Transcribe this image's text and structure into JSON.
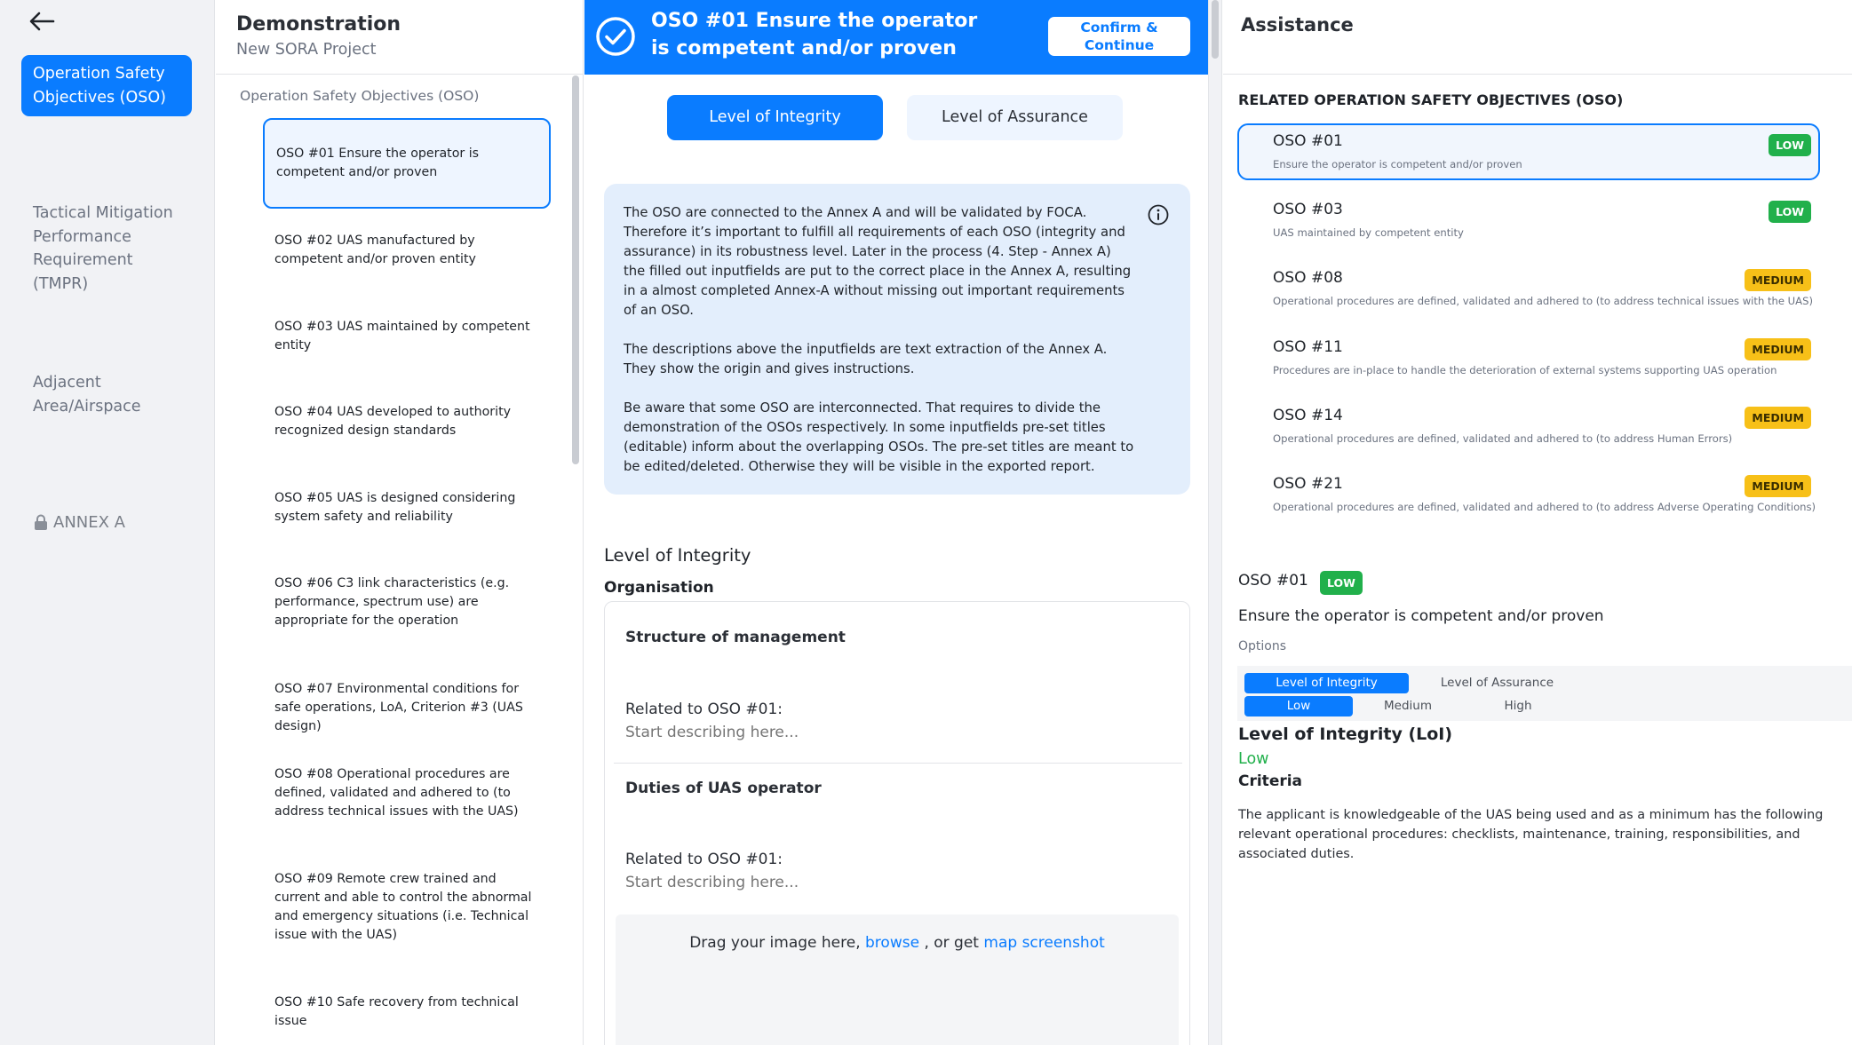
{
  "nav": {
    "items": [
      {
        "label": "Operation Safety Objectives (OSO)"
      },
      {
        "label": "Tactical Mitigation Performance Requirement (TMPR)"
      },
      {
        "label": "Adjacent Area/Airspace"
      }
    ],
    "annex_label": "ANNEX A"
  },
  "list": {
    "title": "Demonstration",
    "subtitle": "New SORA Project",
    "section": "Operation Safety Objectives (OSO)",
    "items": [
      {
        "label": "OSO #01 Ensure the operator is competent and/or proven"
      },
      {
        "label": "OSO #02 UAS manufactured by competent and/or proven entity"
      },
      {
        "label": "OSO #03 UAS maintained by competent entity"
      },
      {
        "label": "OSO #04 UAS developed to authority recognized design standards"
      },
      {
        "label": "OSO #05 UAS is designed considering system safety and reliability"
      },
      {
        "label": "OSO #06 C3 link characteristics (e.g. performance, spectrum use) are appropriate for the operation"
      },
      {
        "label": "OSO #07 Environmental conditions for safe operations, LoA, Criterion #3 (UAS design)"
      },
      {
        "label": "OSO #08 Operational procedures are defined, validated and adhered to (to address technical issues with the UAS)"
      },
      {
        "label": "OSO #09 Remote crew trained and current and able to control the abnormal and emergency situations (i.e. Technical issue with the UAS)"
      },
      {
        "label": "OSO #10 Safe recovery from technical issue"
      }
    ]
  },
  "main": {
    "banner_title": "OSO #01 Ensure the operator is competent and/or proven",
    "confirm_label": "Confirm & Continue",
    "tabs": [
      {
        "label": "Level of Integrity"
      },
      {
        "label": "Level of Assurance"
      }
    ],
    "info": [
      "The OSO are connected to the Annex A and will be validated by FOCA. Therefore it’s important to fulfill all requirements of each OSO (integrity and assurance) in its robustness level. Later in the process (4. Step - Annex A) the filled out inputfields are put to the correct place in the Annex A, resulting in a almost completed Annex-A without missing out important requirements of an OSO.",
      "The descriptions above the inputfields are text extraction of the Annex A. They show the origin and gives instructions.",
      "Be aware that some OSO are interconnected. That requires to divide the demonstration of the OSOs respectively. In some inputfields pre-set titles (editable) inform about the overlapping OSOs. The pre-set titles are meant to be edited/deleted. Otherwise they will be visible in the exported report."
    ],
    "section_heading": "Level of Integrity",
    "sub_heading": "Organisation",
    "fields": [
      {
        "title": "Structure of management",
        "related": "Related to OSO #01:",
        "placeholder": "Start describing here..."
      },
      {
        "title": "Duties of UAS operator",
        "related": "Related to OSO #01:",
        "placeholder": "Start describing here..."
      }
    ],
    "drop": {
      "text": "Drag your image here,",
      "browse": "browse",
      "or": ", or get",
      "map": "map screenshot"
    }
  },
  "assist": {
    "title": "Assistance",
    "related_heading": "RELATED OPERATION SAFETY OBJECTIVES (OSO)",
    "related": [
      {
        "name": "OSO #01",
        "desc": "Ensure the operator is competent and/or proven",
        "level": "LOW"
      },
      {
        "name": "OSO #03",
        "desc": "UAS maintained by competent entity",
        "level": "LOW"
      },
      {
        "name": "OSO #08",
        "desc": "Operational procedures are defined, validated and adhered to (to address technical issues with the UAS)",
        "level": "MEDIUM"
      },
      {
        "name": "OSO #11",
        "desc": "Procedures are in-place to handle the deterioration of external systems supporting UAS operation",
        "level": "MEDIUM"
      },
      {
        "name": "OSO #14",
        "desc": "Operational procedures are defined, validated and adhered to (to address Human Errors)",
        "level": "MEDIUM"
      },
      {
        "name": "OSO #21",
        "desc": "Operational procedures are defined, validated and adhered to (to address Adverse Operating Conditions)",
        "level": "MEDIUM"
      }
    ],
    "detail": {
      "name": "OSO #01",
      "level": "LOW",
      "title": "Ensure the operator is competent and/or proven",
      "options_label": "Options",
      "opt_tabs": [
        "Level of Integrity",
        "Level of Assurance"
      ],
      "levels": [
        "Low",
        "Medium",
        "High"
      ],
      "level_heading": "Level of Integrity (LoI)",
      "level_value": "Low",
      "criteria_heading": "Criteria",
      "criteria_text": "The applicant is knowledgeable of the UAS being used and as a minimum has the following relevant operational procedures: checklists, maintenance, training, responsibilities, and associated duties."
    }
  },
  "colors": {
    "accent": "#0a7cff",
    "low": "#21b04b",
    "medium": "#f7c018"
  }
}
